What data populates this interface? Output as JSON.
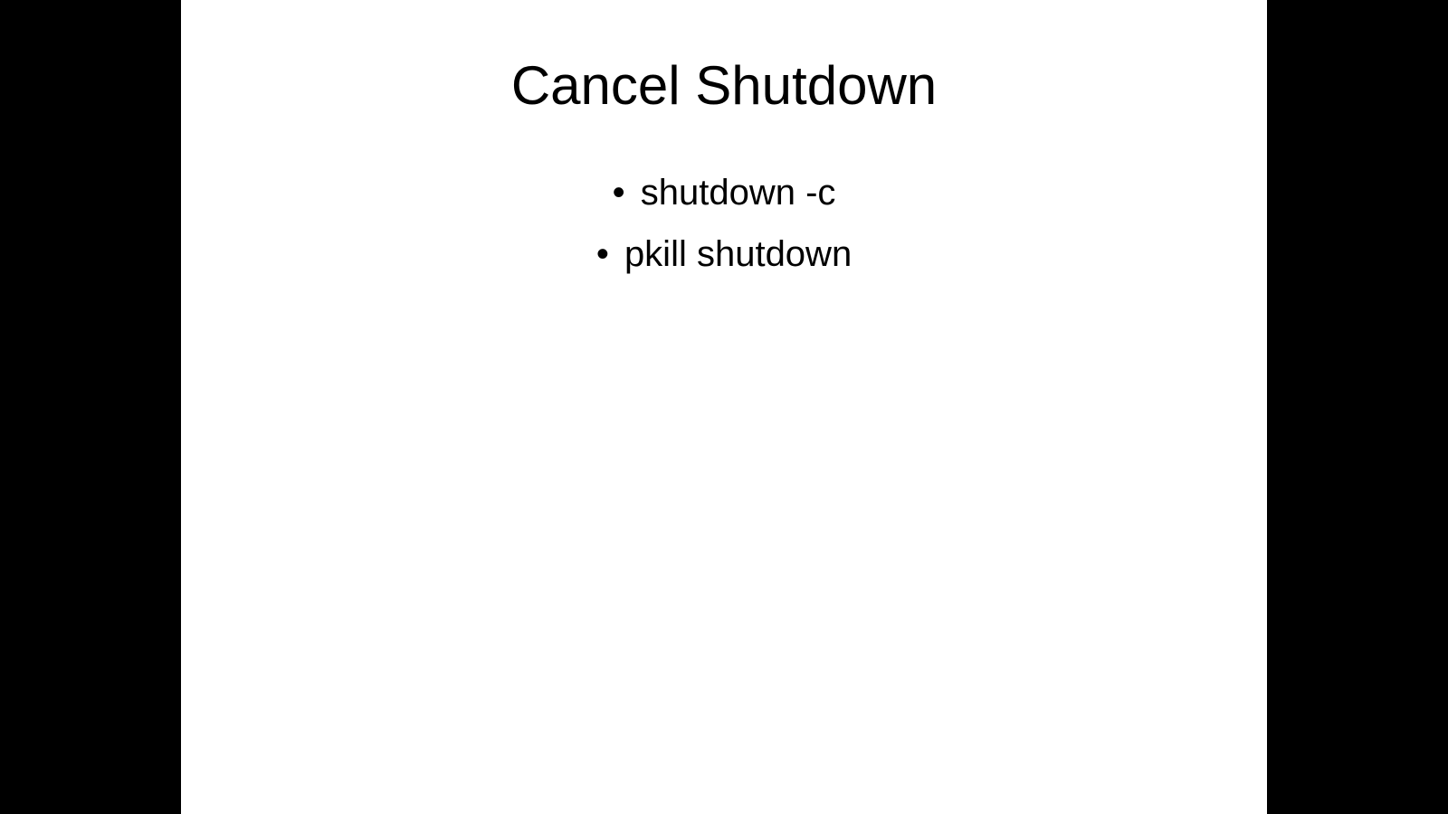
{
  "slide": {
    "title": "Cancel Shutdown",
    "bullets": [
      "shutdown -c",
      "pkill shutdown"
    ]
  }
}
